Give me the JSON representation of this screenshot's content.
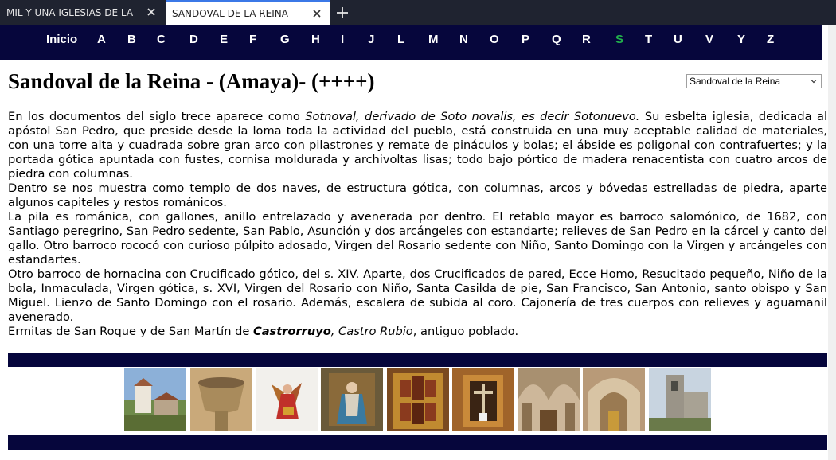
{
  "browser": {
    "tabs": [
      {
        "title": "MIL Y UNA IGLESIAS DE LA DIÓCESIS",
        "active": false
      },
      {
        "title": "SANDOVAL DE LA REINA",
        "active": true
      }
    ],
    "new_tab_icon": "plus-icon",
    "close_icon": "close-icon"
  },
  "nav": {
    "home": "Inicio",
    "letters": [
      "A",
      "B",
      "C",
      "D",
      "E",
      "F",
      "G",
      "H",
      "I",
      "J",
      "L",
      "M",
      "N",
      "O",
      "P",
      "Q",
      "R",
      "S",
      "T",
      "U",
      "V",
      "Y",
      "Z"
    ],
    "active_letter": "S",
    "active_color": "#22b14c",
    "bar_color": "#06063c"
  },
  "page": {
    "title": "Sandoval de la Reina - (Amaya)- (++++)",
    "select_value": "Sandoval de la Reina"
  },
  "content": {
    "p1_a": "En los documentos del siglo trece aparece como ",
    "p1_em": "Sotnoval, derivado de Soto novalis, es decir Sotonuevo.",
    "p1_b": " Su esbelta iglesia, dedicada al apóstol San Pedro, que preside desde la loma toda la actividad del pueblo, está construida en una muy aceptable calidad de materiales, con una torre alta y cuadrada sobre gran arco con pilastrones y remate de pináculos y bolas; el ábside es poligonal con contrafuertes; y la portada gótica apuntada con fustes, cornisa moldurada y archivoltas lisas; todo bajo pórtico de madera renacentista con cuatro arcos de piedra con columnas.",
    "p2": "Dentro se nos muestra como templo de dos naves, de estructura gótica, con columnas, arcos y bóvedas estrelladas de piedra, aparte algunos capiteles y restos románicos.",
    "p3": "La pila es románica, con gallones, anillo entrelazado y avenerada por dentro. El retablo mayor es barroco salomónico, de 1682, con Santiago peregrino, San Pedro sedente, San Pablo, Asunción y dos arcángeles con estandarte; relieves de San Pedro en la cárcel y canto del gallo. Otro barroco rococó con curioso púlpito adosado, Virgen del Rosario sedente con Niño, Santo Domingo con la Virgen y arcángeles con estandartes.",
    "p4": "Otro barroco de hornacina con Crucificado gótico, del s. XIV. Aparte, dos Crucificados de pared, Ecce Homo, Resucitado pequeño, Niño de la bola, Inmaculada, Virgen gótica, s. XVI, Virgen del Rosario con Niño, Santa Casilda de pie, San Francisco, San Antonio, santo obispo y San Miguel. Lienzo de Santo Domingo con el rosario. Además, escalera de subida al coro. Cajonería de tres cuerpos con relieves y aguamanil avenerado.",
    "p5_a": "Ermitas de San Roque y de San Martín de ",
    "p5_strong": "Castrorruyo",
    "p5_em": ", Castro Rubio",
    "p5_b": ", antiguo poblado."
  },
  "gallery": {
    "photos": [
      {
        "subject": "village-church-exterior"
      },
      {
        "subject": "romanesque-baptismal-font"
      },
      {
        "subject": "archangel-statue"
      },
      {
        "subject": "virgin-statue"
      },
      {
        "subject": "baroque-main-altarpiece"
      },
      {
        "subject": "crucifix-niche"
      },
      {
        "subject": "church-interior-vaults"
      },
      {
        "subject": "nave-interior"
      },
      {
        "subject": "tower-exterior"
      }
    ]
  }
}
